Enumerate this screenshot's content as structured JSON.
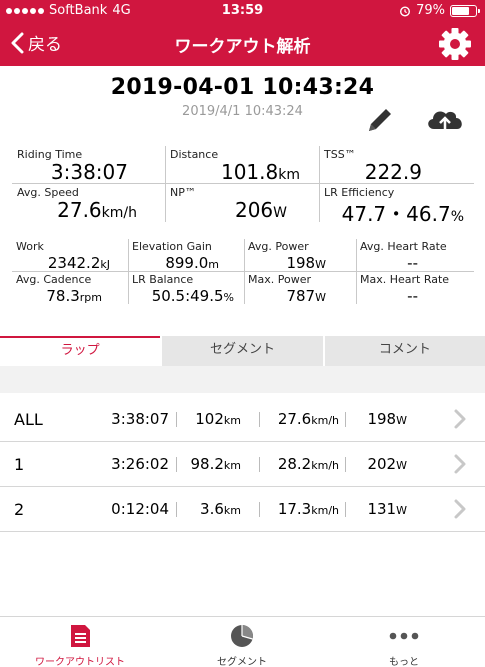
{
  "status": {
    "carrier": "SoftBank",
    "network": "4G",
    "time": "13:59",
    "battery": "79%",
    "battery_level": 0.79
  },
  "nav": {
    "back_label": "戻る",
    "title": "ワークアウト解析"
  },
  "workout": {
    "date": "2019-04-01 10:43:24",
    "date_sub": "2019/4/1 10:43:24"
  },
  "metrics": {
    "riding_time": {
      "label": "Riding Time",
      "value": "3:38:07",
      "unit": ""
    },
    "distance": {
      "label": "Distance",
      "value": "101.8",
      "unit": "km"
    },
    "tss": {
      "label": "TSS™",
      "value": "222.9",
      "unit": ""
    },
    "avg_speed": {
      "label": "Avg. Speed",
      "value": "27.6",
      "unit": "km/h"
    },
    "np": {
      "label": "NP™",
      "value": "206",
      "unit": "W"
    },
    "lr_efficiency": {
      "label": "LR Efficiency",
      "value": "47.7・46.7",
      "unit": "%"
    },
    "work": {
      "label": "Work",
      "value": "2342.2",
      "unit": "kJ"
    },
    "elevation_gain": {
      "label": "Elevation Gain",
      "value": "899.0",
      "unit": "m"
    },
    "avg_power": {
      "label": "Avg. Power",
      "value": "198",
      "unit": "W"
    },
    "avg_hr": {
      "label": "Avg. Heart Rate",
      "value": "--",
      "unit": ""
    },
    "avg_cadence": {
      "label": "Avg. Cadence",
      "value": "78.3",
      "unit": "rpm"
    },
    "lr_balance": {
      "label": "LR Balance",
      "value": "50.5:49.5",
      "unit": "%"
    },
    "max_power": {
      "label": "Max. Power",
      "value": "787",
      "unit": "W"
    },
    "max_hr": {
      "label": "Max. Heart Rate",
      "value": "--",
      "unit": ""
    }
  },
  "tabs": [
    "ラップ",
    "セグメント",
    "コメント"
  ],
  "laps": [
    {
      "name": "ALL",
      "time": "3:38:07",
      "distance": "102",
      "distance_unit": "km",
      "speed": "27.6",
      "speed_unit": "km/h",
      "power": "198",
      "power_unit": "W"
    },
    {
      "name": "1",
      "time": "3:26:02",
      "distance": "98.2",
      "distance_unit": "km",
      "speed": "28.2",
      "speed_unit": "km/h",
      "power": "202",
      "power_unit": "W"
    },
    {
      "name": "2",
      "time": "0:12:04",
      "distance": "3.6",
      "distance_unit": "km",
      "speed": "17.3",
      "speed_unit": "km/h",
      "power": "131",
      "power_unit": "W"
    }
  ],
  "tabbar": [
    {
      "label": "ワークアウトリスト",
      "icon": "workout-list-icon",
      "active": true
    },
    {
      "label": "セグメント",
      "icon": "pie-chart-icon",
      "active": false
    },
    {
      "label": "もっと",
      "icon": "more-dots-icon",
      "active": false
    }
  ],
  "colors": {
    "accent": "#d0163f",
    "grid_line": "#c9c9c9",
    "subtle_text": "#9a9a9a"
  }
}
